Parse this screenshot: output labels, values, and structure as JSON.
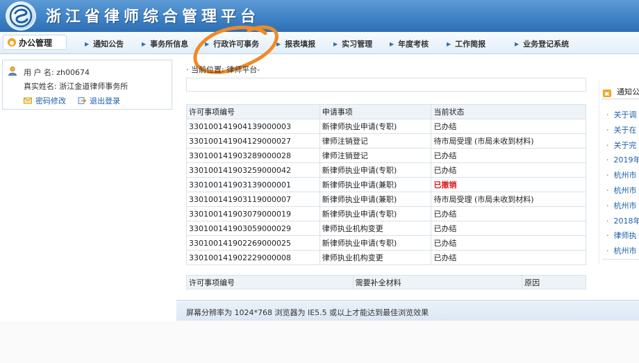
{
  "header": {
    "title": "浙江省律师综合管理平台",
    "logo_icon": "logo-emblem-icon"
  },
  "nav": {
    "home": "办公管理",
    "items": [
      "通知公告",
      "事务所信息",
      "行政许可事务",
      "报表填报",
      "实习管理",
      "年度考核",
      "工作简报",
      "业务登记系统"
    ]
  },
  "user": {
    "username_label": "用 户 名:",
    "username": "zh00674",
    "realname_label": "真实姓名:",
    "realname": "浙江金道律师事务所",
    "change_password": "密码修改",
    "logout": "退出登录"
  },
  "breadcrumb": "· 当前位置: 律师平台-",
  "permit_table": {
    "headers": [
      "许可事项编号",
      "申请事项",
      "当前状态"
    ],
    "rows": [
      [
        "330100141904139000003",
        "新律师执业申请(专职)",
        "已办结"
      ],
      [
        "330100141904129000027",
        "律师注销登记",
        "待市局受理 (市局未收到材料)"
      ],
      [
        "330100141903289000028",
        "律师注销登记",
        "已办结"
      ],
      [
        "330100141903259000042",
        "新律师执业申请(专职)",
        "已办结"
      ],
      [
        "330100141903139000001",
        "新律师执业申请(兼职)",
        "已撤销"
      ],
      [
        "330100141903119000007",
        "新律师执业申请(兼职)",
        "待市局受理 (市局未收到材料)"
      ],
      [
        "330100141903079000019",
        "新律师执业申请(专职)",
        "已办结"
      ],
      [
        "330100141903059000029",
        "律师执业机构变更",
        "已办结"
      ],
      [
        "330100141902269000025",
        "新律师执业申请(专职)",
        "已办结"
      ],
      [
        "330100141902229000008",
        "律师执业机构变更",
        "已办结"
      ]
    ]
  },
  "supplement_table": {
    "headers": [
      "许可事项编号",
      "需要补全材料",
      "原因"
    ]
  },
  "notices": {
    "title": "通知公",
    "items": [
      "关于调",
      "关于在",
      "关于完",
      "2019年",
      "杭州市",
      "杭州市",
      "杭州市",
      "2018年",
      "律师执",
      "杭州市"
    ]
  },
  "footer": "屏幕分辨率为 1024*768 浏览器为 IE5.5 或以上才能达到最佳浏览效果",
  "colors": {
    "header_blue": "#3f82c6",
    "link_blue": "#1a5fa8",
    "alert_red": "#d61c1c",
    "annotation_orange": "#f08a24"
  }
}
